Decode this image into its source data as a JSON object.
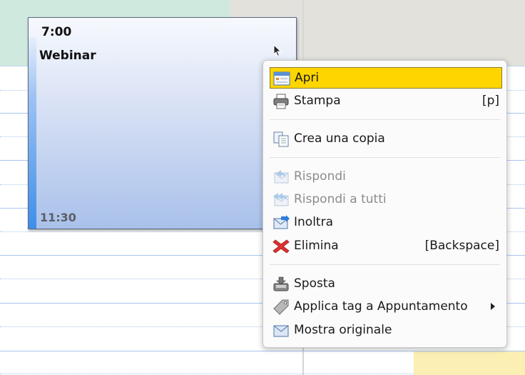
{
  "event": {
    "start_time": "7:00",
    "title": "Webinar",
    "end_time": "11:30"
  },
  "context_menu": {
    "items": [
      {
        "label": "Apri",
        "shortcut": "",
        "icon": "calendar-open-icon",
        "selected": true,
        "disabled": false
      },
      {
        "label": "Stampa",
        "shortcut": "[p]",
        "icon": "printer-icon",
        "selected": false,
        "disabled": false
      },
      {
        "label": "Crea una copia",
        "shortcut": "",
        "icon": "copy-icon",
        "selected": false,
        "disabled": false
      },
      {
        "label": "Rispondi",
        "shortcut": "",
        "icon": "reply-icon",
        "selected": false,
        "disabled": true
      },
      {
        "label": "Rispondi a tutti",
        "shortcut": "",
        "icon": "reply-all-icon",
        "selected": false,
        "disabled": true
      },
      {
        "label": "Inoltra",
        "shortcut": "",
        "icon": "forward-icon",
        "selected": false,
        "disabled": false
      },
      {
        "label": "Elimina",
        "shortcut": "[Backspace]",
        "icon": "delete-icon",
        "selected": false,
        "disabled": false
      },
      {
        "label": "Sposta",
        "shortcut": "",
        "icon": "move-icon",
        "selected": false,
        "disabled": false
      },
      {
        "label": "Applica tag a Appuntamento",
        "shortcut": "",
        "icon": "tag-icon",
        "selected": false,
        "disabled": false,
        "submenu": true
      },
      {
        "label": "Mostra originale",
        "shortcut": "",
        "icon": "envelope-icon",
        "selected": false,
        "disabled": false
      }
    ]
  },
  "colors": {
    "selection": "#ffd500",
    "event_accent": "#3e8ee8",
    "day_header": "#cfe9df",
    "grid_line": "#a9c6ee",
    "delete_red": "#e03030"
  }
}
